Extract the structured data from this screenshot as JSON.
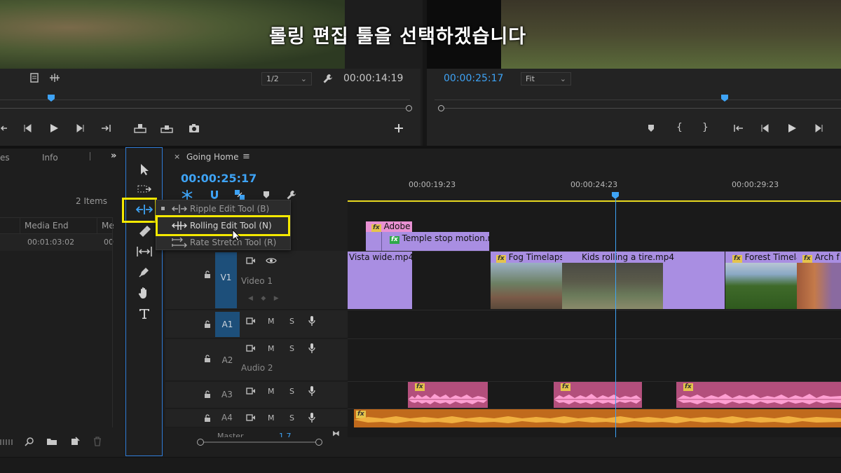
{
  "caption": "롤링 편집 툴을 선택하겠습니다",
  "source_monitor": {
    "resolution": "1/2",
    "timecode": "00:00:14:19"
  },
  "program_monitor": {
    "timecode": "00:00:25:17",
    "zoom": "Fit"
  },
  "project_panel": {
    "tabs": [
      "es",
      "Info"
    ],
    "items_count": "2 Items",
    "columns": [
      "Media End",
      "Me"
    ],
    "row": {
      "media_end": "00:01:03:02",
      "me": "00"
    }
  },
  "tool_menu": {
    "items": [
      {
        "label": "Ripple Edit Tool (B)",
        "active": true
      },
      {
        "label": "Rolling Edit Tool (N)",
        "hovered": true
      },
      {
        "label": "Rate Stretch Tool (R)"
      }
    ]
  },
  "sequence": {
    "name": "Going Home",
    "timecode": "00:00:25:17",
    "ruler": [
      "00:00:19:23",
      "00:00:24:23",
      "00:00:29:23"
    ],
    "tracks": {
      "v1": {
        "tag": "V1",
        "name": "Video 1"
      },
      "a1": {
        "tag": "A1"
      },
      "a2": {
        "tag": "A2",
        "name": "Audio 2"
      },
      "a3": {
        "tag": "A3"
      },
      "a4": {
        "tag": "A4"
      },
      "master": {
        "name": "Master",
        "value": "1.7"
      }
    },
    "track_buttons": {
      "m": "M",
      "s": "S"
    },
    "clips": {
      "adobe": "Adobe",
      "temple": "Temple stop motion.mp4",
      "vista": "Vista wide.mp4",
      "fog": "Fog Timelapse",
      "kids": "Kids rolling a tire.mp4",
      "forest": "Forest Timelapse",
      "arch": "Arch f"
    },
    "fx": "fx"
  },
  "colors": {
    "accent_blue": "#3ea3f5",
    "highlight_yellow": "#f4e900",
    "video_clip": "#a98ee2",
    "audio_clip": "#b34f7c",
    "audio_clip_orange": "#c06a1c"
  }
}
